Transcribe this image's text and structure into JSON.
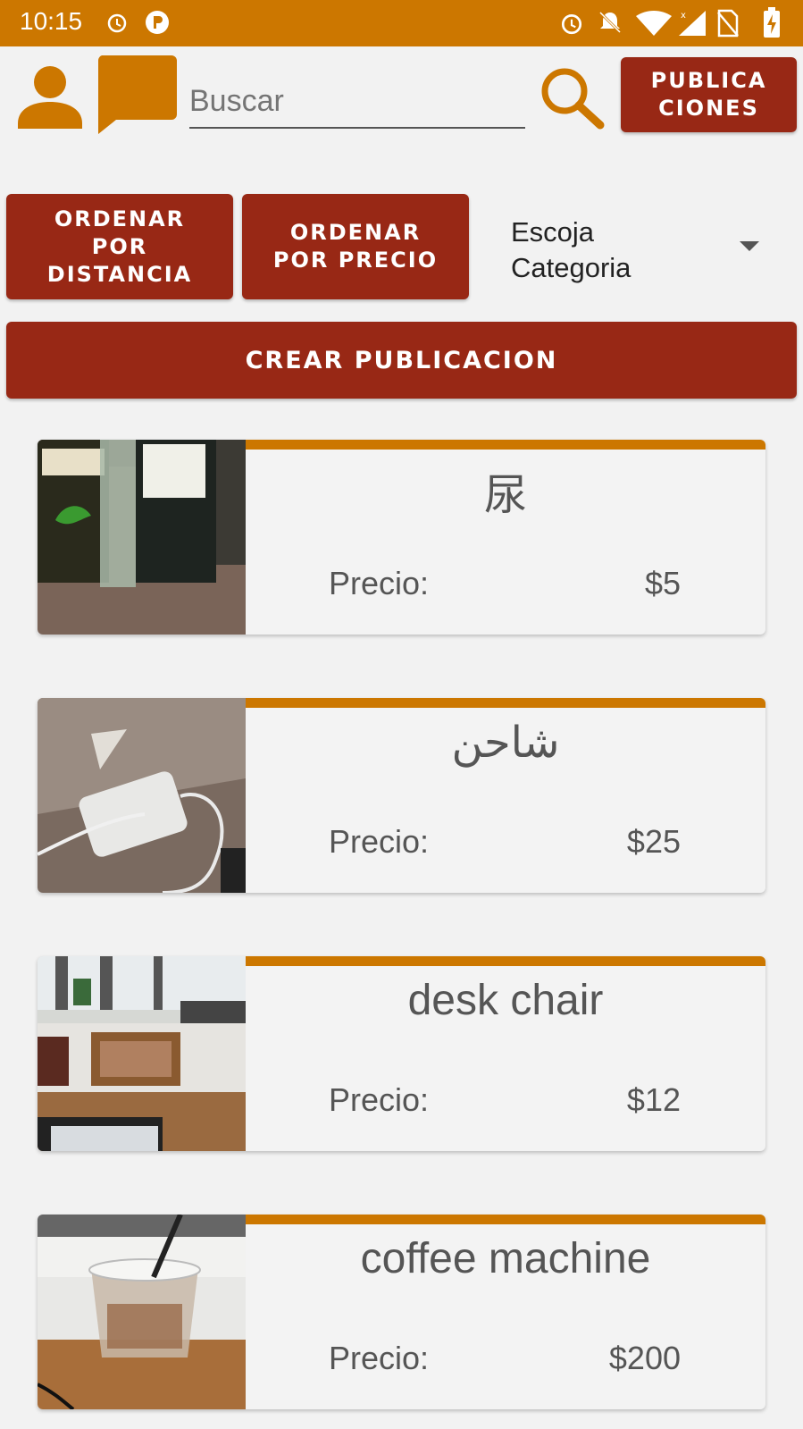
{
  "status_bar": {
    "time": "10:15",
    "icons": [
      "alarm-icon",
      "p-app-icon",
      "alarm-icon",
      "notifications-off-icon",
      "wifi-icon",
      "signal-icon",
      "no-sim-icon",
      "battery-charging-icon"
    ]
  },
  "header": {
    "search_placeholder": "Buscar",
    "publicaciones_label": "PUBLICA\nCIONES"
  },
  "controls": {
    "sort_distance_label": "ORDENAR\nPOR\nDISTANCIA",
    "sort_price_label": "ORDENAR\nPOR PRECIO",
    "category_select": "Escoja\nCategoria",
    "create_label": "CREAR PUBLICACION"
  },
  "listings": [
    {
      "title": "尿",
      "price_label": "Precio:",
      "price": "$5",
      "image": "drink-bottle-photo"
    },
    {
      "title": "شاحن",
      "price_label": "Precio:",
      "price": "$25",
      "image": "charger-photo"
    },
    {
      "title": "desk chair",
      "price_label": "Precio:",
      "price": "$12",
      "image": "desk-chair-photo"
    },
    {
      "title": "coffee machine",
      "price_label": "Precio:",
      "price": "$200",
      "image": "coffee-cup-photo"
    }
  ],
  "colors": {
    "status_bar": "#cc7700",
    "accent": "#cc7700",
    "button": "#982815",
    "background": "#f2f2f2"
  }
}
